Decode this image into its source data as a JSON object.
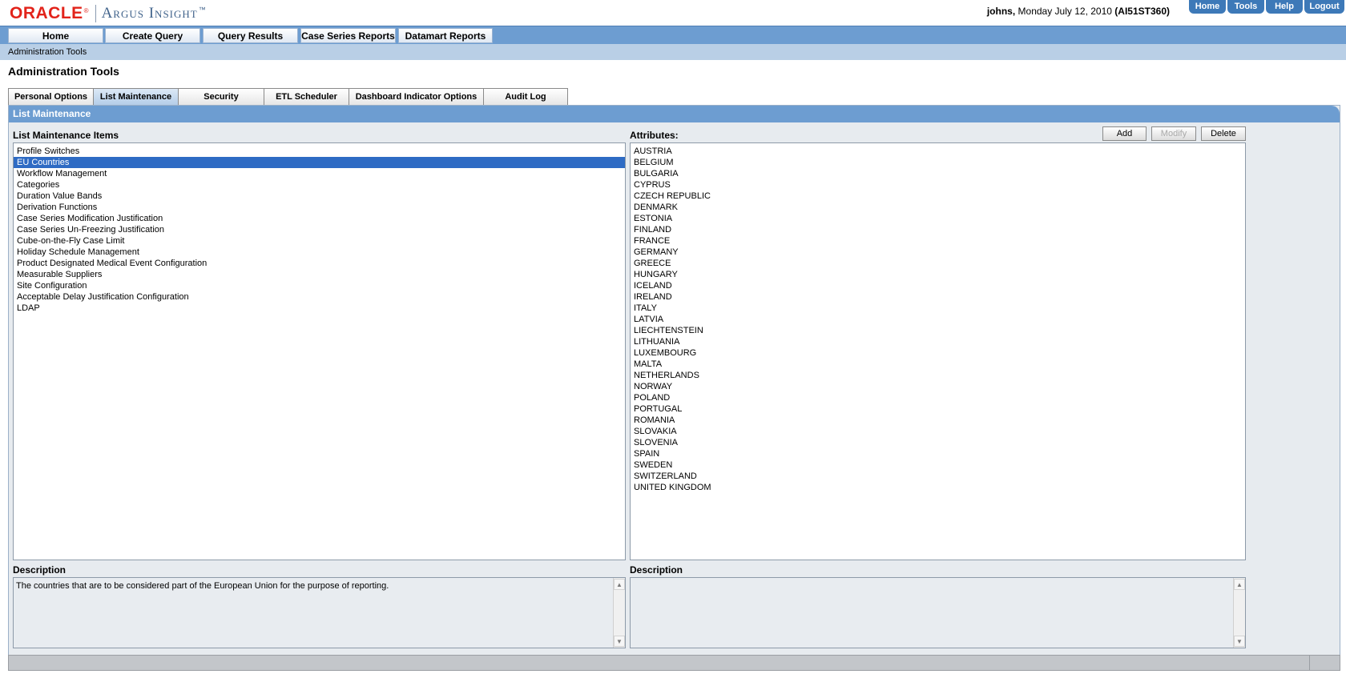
{
  "header": {
    "logo_oracle": "ORACLE",
    "logo_product": "Argus Insight",
    "user": "johns,",
    "date": "Monday July 12, 2010",
    "server": "(AI51ST360)",
    "top_links": [
      "Home",
      "Tools",
      "Help",
      "Logout"
    ]
  },
  "nav": {
    "items": [
      "Home",
      "Create Query",
      "Query Results",
      "Case Series Reports",
      "Datamart Reports"
    ]
  },
  "breadcrumb": "Administration Tools",
  "page_title": "Administration Tools",
  "tabs": [
    "Personal Options",
    "List Maintenance",
    "Security",
    "ETL Scheduler",
    "Dashboard Indicator Options",
    "Audit Log"
  ],
  "active_tab": "List Maintenance",
  "panel": {
    "title": "List Maintenance",
    "left_label": "List Maintenance Items",
    "right_label": "Attributes:",
    "buttons": {
      "add": "Add",
      "modify": "Modify",
      "delete": "Delete"
    },
    "items": [
      "Profile Switches",
      "EU Countries",
      "Workflow Management",
      "Categories",
      "Duration Value Bands",
      "Derivation Functions",
      "Case Series Modification Justification",
      "Case Series Un-Freezing Justification",
      "Cube-on-the-Fly Case Limit",
      "Holiday Schedule Management",
      "Product Designated Medical Event Configuration",
      "Measurable Suppliers",
      "Site Configuration",
      "Acceptable Delay Justification Configuration",
      "LDAP"
    ],
    "selected_item": "EU Countries",
    "attributes": [
      "AUSTRIA",
      "BELGIUM",
      "BULGARIA",
      "CYPRUS",
      "CZECH REPUBLIC",
      "DENMARK",
      "ESTONIA",
      "FINLAND",
      "FRANCE",
      "GERMANY",
      "GREECE",
      "HUNGARY",
      "ICELAND",
      "IRELAND",
      "ITALY",
      "LATVIA",
      "LIECHTENSTEIN",
      "LITHUANIA",
      "LUXEMBOURG",
      "MALTA",
      "NETHERLANDS",
      "NORWAY",
      "POLAND",
      "PORTUGAL",
      "ROMANIA",
      "SLOVAKIA",
      "SLOVENIA",
      "SPAIN",
      "SWEDEN",
      "SWITZERLAND",
      "UNITED KINGDOM"
    ],
    "left_desc_label": "Description",
    "left_desc_text": "The countries that are to be considered part of the European Union for the purpose of reporting.",
    "right_desc_label": "Description",
    "right_desc_text": ""
  },
  "colors": {
    "nav_bar": "#6d9dd1",
    "breadcrumb_bar": "#b9cfe6",
    "selection": "#2e6bc4",
    "oracle_red": "#e2231a",
    "toplink": "#3d79b8"
  }
}
